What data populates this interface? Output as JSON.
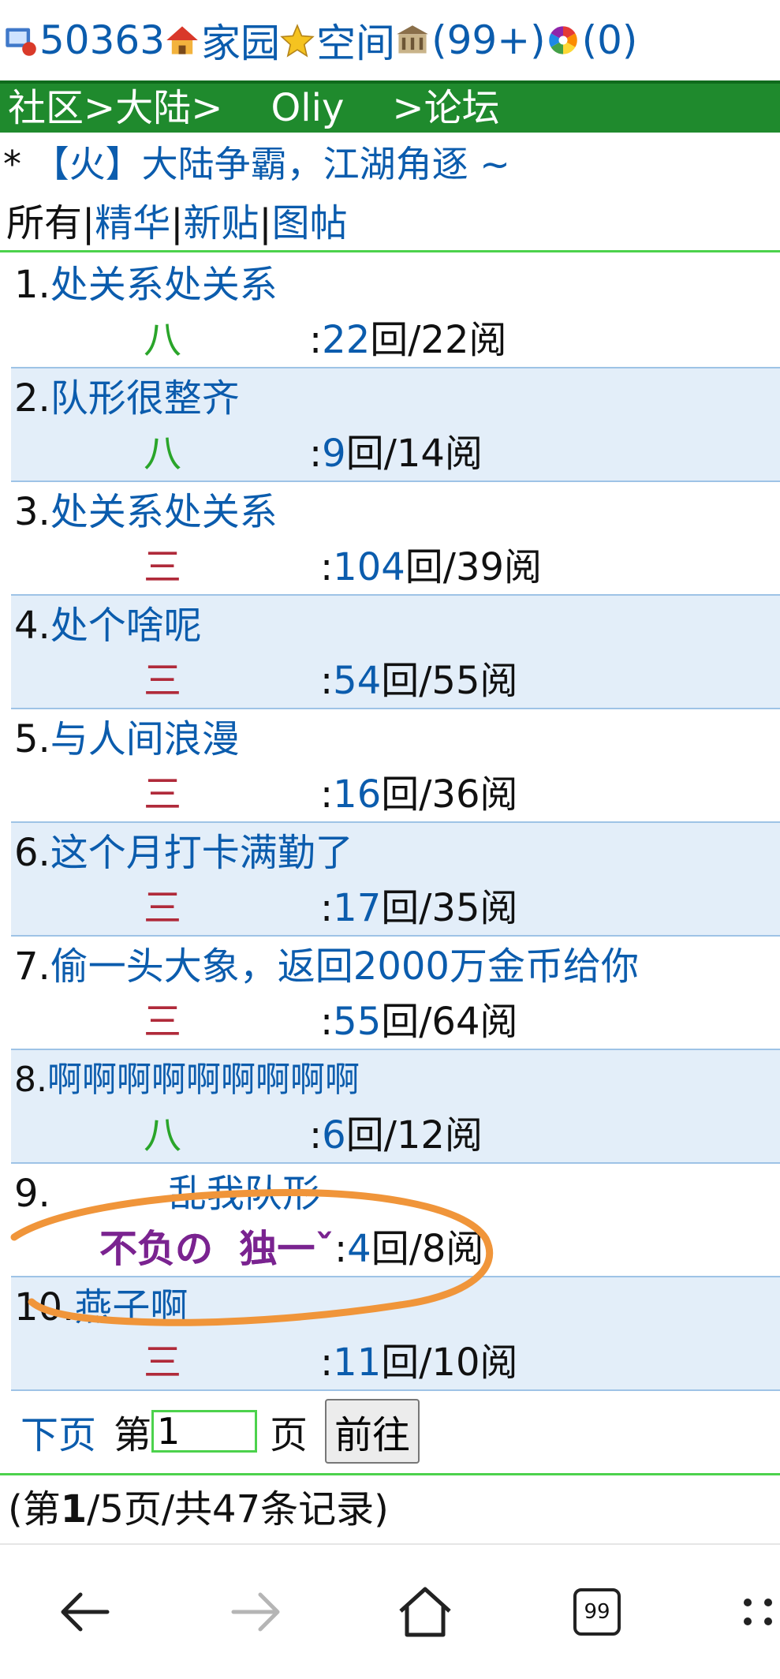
{
  "topbar": {
    "user_id": "50363",
    "home_label": "家园",
    "space_label": "空间",
    "messages_count": "(99+)",
    "notify_count": "(0)"
  },
  "breadcrumb": {
    "community": "社区>",
    "continent": "大陆>",
    "user": "Oliy",
    "forum": ">论坛"
  },
  "forum": {
    "star": "*",
    "title": "【火】大陆争霸，江湖角逐 ~"
  },
  "filters": {
    "all": "所有",
    "sep": "|",
    "featured": "精华",
    "new": "新贴",
    "images": "图帖"
  },
  "posts": [
    {
      "num": "1.",
      "title": "处关系处关系",
      "author": "八",
      "replies": "22",
      "stats": "回/22阅"
    },
    {
      "num": "2.",
      "title": "队形很整齐",
      "author": "八",
      "replies": "9",
      "stats": "回/14阅"
    },
    {
      "num": "3.",
      "title": "处关系处关系",
      "author": "三",
      "replies": "104",
      "stats": "回/39阅"
    },
    {
      "num": "4.",
      "title": "处个啥呢",
      "author": "三",
      "replies": "54",
      "stats": "回/55阅"
    },
    {
      "num": "5.",
      "title": "与人间浪漫",
      "author": "三",
      "replies": "16",
      "stats": "回/36阅"
    },
    {
      "num": "6.",
      "title": "这个月打卡满勤了",
      "author": "三",
      "replies": "17",
      "stats": "回/35阅"
    },
    {
      "num": "7.",
      "title": "偷一头大象，返回2000万金币给你",
      "author": "三",
      "replies": "55",
      "stats": "回/64阅"
    },
    {
      "num": "8.",
      "title": "啊啊啊啊啊啊啊啊啊",
      "author": "八",
      "replies": "6",
      "stats": "回/12阅"
    },
    {
      "num": "9.",
      "title": "乱我队形",
      "author": "不负の  独一ˇ",
      "replies": "4",
      "stats": "回/8阅"
    },
    {
      "num": "10.",
      "title": "燕子啊",
      "author": "三",
      "replies": "11",
      "stats": "回/10阅"
    }
  ],
  "pager": {
    "next": "下页",
    "page_prefix": "第",
    "page_value": "1",
    "page_suffix": "页",
    "go": "前往"
  },
  "summary": {
    "open": "(第",
    "current": "1",
    "rest": "/5页/共47条记录)"
  },
  "nav": {
    "tabs_count": "99"
  },
  "colors": {
    "link": "#0b5cad",
    "header_green": "#1f8a2d",
    "row_alt": "#e3eef9",
    "annotation": "#f0953a"
  }
}
